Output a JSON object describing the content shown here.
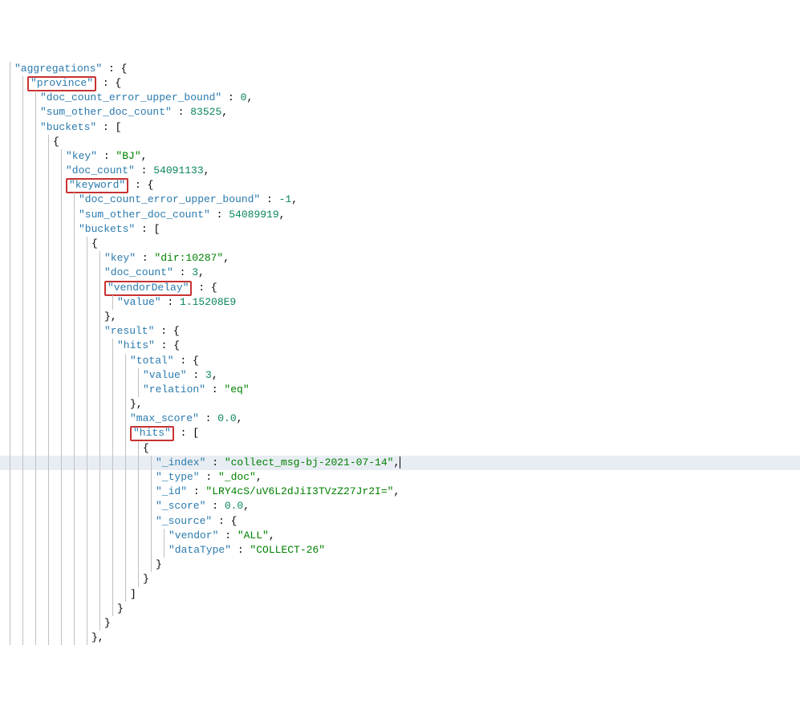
{
  "lines": [
    {
      "guides": [
        0
      ],
      "indent": 0,
      "segments": [
        {
          "t": "key",
          "v": "\"aggregations\""
        },
        {
          "t": "punc",
          "v": " : {"
        }
      ]
    },
    {
      "guides": [
        0,
        1
      ],
      "indent": 1,
      "segments": [
        {
          "t": "box",
          "inner": [
            {
              "t": "key",
              "v": "\"province\""
            }
          ]
        },
        {
          "t": "punc",
          "v": " : {"
        }
      ]
    },
    {
      "guides": [
        0,
        1,
        2
      ],
      "indent": 2,
      "segments": [
        {
          "t": "key",
          "v": "\"doc_count_error_upper_bound\""
        },
        {
          "t": "punc",
          "v": " : "
        },
        {
          "t": "num",
          "v": "0"
        },
        {
          "t": "punc",
          "v": ","
        }
      ]
    },
    {
      "guides": [
        0,
        1,
        2
      ],
      "indent": 2,
      "segments": [
        {
          "t": "key",
          "v": "\"sum_other_doc_count\""
        },
        {
          "t": "punc",
          "v": " : "
        },
        {
          "t": "num",
          "v": "83525"
        },
        {
          "t": "punc",
          "v": ","
        }
      ]
    },
    {
      "guides": [
        0,
        1,
        2
      ],
      "indent": 2,
      "segments": [
        {
          "t": "key",
          "v": "\"buckets\""
        },
        {
          "t": "punc",
          "v": " : ["
        }
      ]
    },
    {
      "guides": [
        0,
        1,
        2,
        3
      ],
      "indent": 3,
      "segments": [
        {
          "t": "punc",
          "v": "{"
        }
      ]
    },
    {
      "guides": [
        0,
        1,
        2,
        3,
        4
      ],
      "indent": 4,
      "segments": [
        {
          "t": "key",
          "v": "\"key\""
        },
        {
          "t": "punc",
          "v": " : "
        },
        {
          "t": "str",
          "v": "\"BJ\""
        },
        {
          "t": "punc",
          "v": ","
        }
      ]
    },
    {
      "guides": [
        0,
        1,
        2,
        3,
        4
      ],
      "indent": 4,
      "segments": [
        {
          "t": "key",
          "v": "\"doc_count\""
        },
        {
          "t": "punc",
          "v": " : "
        },
        {
          "t": "num",
          "v": "54091133"
        },
        {
          "t": "punc",
          "v": ","
        }
      ]
    },
    {
      "guides": [
        0,
        1,
        2,
        3,
        4
      ],
      "indent": 4,
      "segments": [
        {
          "t": "box",
          "inner": [
            {
              "t": "key",
              "v": "\"keyword\""
            }
          ]
        },
        {
          "t": "punc",
          "v": " : {"
        }
      ]
    },
    {
      "guides": [
        0,
        1,
        2,
        3,
        4,
        5
      ],
      "indent": 5,
      "segments": [
        {
          "t": "key",
          "v": "\"doc_count_error_upper_bound\""
        },
        {
          "t": "punc",
          "v": " : "
        },
        {
          "t": "num",
          "v": "-1"
        },
        {
          "t": "punc",
          "v": ","
        }
      ]
    },
    {
      "guides": [
        0,
        1,
        2,
        3,
        4,
        5
      ],
      "indent": 5,
      "segments": [
        {
          "t": "key",
          "v": "\"sum_other_doc_count\""
        },
        {
          "t": "punc",
          "v": " : "
        },
        {
          "t": "num",
          "v": "54089919"
        },
        {
          "t": "punc",
          "v": ","
        }
      ]
    },
    {
      "guides": [
        0,
        1,
        2,
        3,
        4,
        5
      ],
      "indent": 5,
      "segments": [
        {
          "t": "key",
          "v": "\"buckets\""
        },
        {
          "t": "punc",
          "v": " : ["
        }
      ]
    },
    {
      "guides": [
        0,
        1,
        2,
        3,
        4,
        5,
        6
      ],
      "indent": 6,
      "segments": [
        {
          "t": "punc",
          "v": "{"
        }
      ]
    },
    {
      "guides": [
        0,
        1,
        2,
        3,
        4,
        5,
        6,
        7
      ],
      "indent": 7,
      "segments": [
        {
          "t": "key",
          "v": "\"key\""
        },
        {
          "t": "punc",
          "v": " : "
        },
        {
          "t": "str",
          "v": "\"dir:10287\""
        },
        {
          "t": "punc",
          "v": ","
        }
      ]
    },
    {
      "guides": [
        0,
        1,
        2,
        3,
        4,
        5,
        6,
        7
      ],
      "indent": 7,
      "segments": [
        {
          "t": "key",
          "v": "\"doc_count\""
        },
        {
          "t": "punc",
          "v": " : "
        },
        {
          "t": "num",
          "v": "3"
        },
        {
          "t": "punc",
          "v": ","
        }
      ]
    },
    {
      "guides": [
        0,
        1,
        2,
        3,
        4,
        5,
        6,
        7
      ],
      "indent": 7,
      "segments": [
        {
          "t": "box",
          "inner": [
            {
              "t": "key",
              "v": "\"vendorDelay\""
            }
          ]
        },
        {
          "t": "punc",
          "v": " : {"
        }
      ]
    },
    {
      "guides": [
        0,
        1,
        2,
        3,
        4,
        5,
        6,
        7,
        8
      ],
      "indent": 8,
      "segments": [
        {
          "t": "key",
          "v": "\"value\""
        },
        {
          "t": "punc",
          "v": " : "
        },
        {
          "t": "num",
          "v": "1.15208E9"
        }
      ]
    },
    {
      "guides": [
        0,
        1,
        2,
        3,
        4,
        5,
        6,
        7
      ],
      "indent": 7,
      "segments": [
        {
          "t": "punc",
          "v": "},"
        }
      ]
    },
    {
      "guides": [
        0,
        1,
        2,
        3,
        4,
        5,
        6,
        7
      ],
      "indent": 7,
      "segments": [
        {
          "t": "key",
          "v": "\"result\""
        },
        {
          "t": "punc",
          "v": " : {"
        }
      ]
    },
    {
      "guides": [
        0,
        1,
        2,
        3,
        4,
        5,
        6,
        7,
        8
      ],
      "indent": 8,
      "segments": [
        {
          "t": "key",
          "v": "\"hits\""
        },
        {
          "t": "punc",
          "v": " : {"
        }
      ]
    },
    {
      "guides": [
        0,
        1,
        2,
        3,
        4,
        5,
        6,
        7,
        8,
        9
      ],
      "indent": 9,
      "segments": [
        {
          "t": "key",
          "v": "\"total\""
        },
        {
          "t": "punc",
          "v": " : {"
        }
      ]
    },
    {
      "guides": [
        0,
        1,
        2,
        3,
        4,
        5,
        6,
        7,
        8,
        9,
        10
      ],
      "indent": 10,
      "segments": [
        {
          "t": "key",
          "v": "\"value\""
        },
        {
          "t": "punc",
          "v": " : "
        },
        {
          "t": "num",
          "v": "3"
        },
        {
          "t": "punc",
          "v": ","
        }
      ]
    },
    {
      "guides": [
        0,
        1,
        2,
        3,
        4,
        5,
        6,
        7,
        8,
        9,
        10
      ],
      "indent": 10,
      "segments": [
        {
          "t": "key",
          "v": "\"relation\""
        },
        {
          "t": "punc",
          "v": " : "
        },
        {
          "t": "str",
          "v": "\"eq\""
        }
      ]
    },
    {
      "guides": [
        0,
        1,
        2,
        3,
        4,
        5,
        6,
        7,
        8,
        9
      ],
      "indent": 9,
      "segments": [
        {
          "t": "punc",
          "v": "},"
        }
      ]
    },
    {
      "guides": [
        0,
        1,
        2,
        3,
        4,
        5,
        6,
        7,
        8,
        9
      ],
      "indent": 9,
      "segments": [
        {
          "t": "key",
          "v": "\"max_score\""
        },
        {
          "t": "punc",
          "v": " : "
        },
        {
          "t": "num",
          "v": "0.0"
        },
        {
          "t": "punc",
          "v": ","
        }
      ]
    },
    {
      "guides": [
        0,
        1,
        2,
        3,
        4,
        5,
        6,
        7,
        8,
        9
      ],
      "indent": 9,
      "segments": [
        {
          "t": "box",
          "inner": [
            {
              "t": "key",
              "v": "\"hits\""
            }
          ]
        },
        {
          "t": "punc",
          "v": " : ["
        }
      ]
    },
    {
      "guides": [
        0,
        1,
        2,
        3,
        4,
        5,
        6,
        7,
        8,
        9,
        10
      ],
      "indent": 10,
      "segments": [
        {
          "t": "punc",
          "v": "{"
        }
      ]
    },
    {
      "guides": [
        0,
        1,
        2,
        3,
        4,
        5,
        6,
        7,
        8,
        9,
        10,
        11
      ],
      "indent": 11,
      "hl": true,
      "segments": [
        {
          "t": "key",
          "v": "\"_index\""
        },
        {
          "t": "punc",
          "v": " : "
        },
        {
          "t": "str",
          "v": "\"collect_msg-bj-2021-07-14\""
        },
        {
          "t": "punc",
          "v": ","
        },
        {
          "t": "cursor",
          "v": ""
        }
      ]
    },
    {
      "guides": [
        0,
        1,
        2,
        3,
        4,
        5,
        6,
        7,
        8,
        9,
        10,
        11
      ],
      "indent": 11,
      "segments": [
        {
          "t": "key",
          "v": "\"_type\""
        },
        {
          "t": "punc",
          "v": " : "
        },
        {
          "t": "str",
          "v": "\"_doc\""
        },
        {
          "t": "punc",
          "v": ","
        }
      ]
    },
    {
      "guides": [
        0,
        1,
        2,
        3,
        4,
        5,
        6,
        7,
        8,
        9,
        10,
        11
      ],
      "indent": 11,
      "segments": [
        {
          "t": "key",
          "v": "\"_id\""
        },
        {
          "t": "punc",
          "v": " : "
        },
        {
          "t": "str",
          "v": "\"LRY4cS/uV6L2dJiI3TVzZ27Jr2I=\""
        },
        {
          "t": "punc",
          "v": ","
        }
      ]
    },
    {
      "guides": [
        0,
        1,
        2,
        3,
        4,
        5,
        6,
        7,
        8,
        9,
        10,
        11
      ],
      "indent": 11,
      "segments": [
        {
          "t": "key",
          "v": "\"_score\""
        },
        {
          "t": "punc",
          "v": " : "
        },
        {
          "t": "num",
          "v": "0.0"
        },
        {
          "t": "punc",
          "v": ","
        }
      ]
    },
    {
      "guides": [
        0,
        1,
        2,
        3,
        4,
        5,
        6,
        7,
        8,
        9,
        10,
        11
      ],
      "indent": 11,
      "segments": [
        {
          "t": "key",
          "v": "\"_source\""
        },
        {
          "t": "punc",
          "v": " : {"
        }
      ]
    },
    {
      "guides": [
        0,
        1,
        2,
        3,
        4,
        5,
        6,
        7,
        8,
        9,
        10,
        11,
        12
      ],
      "indent": 12,
      "segments": [
        {
          "t": "key",
          "v": "\"vendor\""
        },
        {
          "t": "punc",
          "v": " : "
        },
        {
          "t": "str",
          "v": "\"ALL\""
        },
        {
          "t": "punc",
          "v": ","
        }
      ]
    },
    {
      "guides": [
        0,
        1,
        2,
        3,
        4,
        5,
        6,
        7,
        8,
        9,
        10,
        11,
        12
      ],
      "indent": 12,
      "segments": [
        {
          "t": "key",
          "v": "\"dataType\""
        },
        {
          "t": "punc",
          "v": " : "
        },
        {
          "t": "str",
          "v": "\"COLLECT-26\""
        }
      ]
    },
    {
      "guides": [
        0,
        1,
        2,
        3,
        4,
        5,
        6,
        7,
        8,
        9,
        10,
        11
      ],
      "indent": 11,
      "segments": [
        {
          "t": "punc",
          "v": "}"
        }
      ]
    },
    {
      "guides": [
        0,
        1,
        2,
        3,
        4,
        5,
        6,
        7,
        8,
        9,
        10
      ],
      "indent": 10,
      "segments": [
        {
          "t": "punc",
          "v": "}"
        }
      ]
    },
    {
      "guides": [
        0,
        1,
        2,
        3,
        4,
        5,
        6,
        7,
        8,
        9
      ],
      "indent": 9,
      "segments": [
        {
          "t": "punc",
          "v": "]"
        }
      ]
    },
    {
      "guides": [
        0,
        1,
        2,
        3,
        4,
        5,
        6,
        7,
        8
      ],
      "indent": 8,
      "segments": [
        {
          "t": "punc",
          "v": "}"
        }
      ]
    },
    {
      "guides": [
        0,
        1,
        2,
        3,
        4,
        5,
        6,
        7
      ],
      "indent": 7,
      "segments": [
        {
          "t": "punc",
          "v": "}"
        }
      ]
    },
    {
      "guides": [
        0,
        1,
        2,
        3,
        4,
        5,
        6
      ],
      "indent": 6,
      "segments": [
        {
          "t": "punc",
          "v": "},"
        }
      ]
    }
  ],
  "indentPx": 16,
  "guideStart": 12
}
